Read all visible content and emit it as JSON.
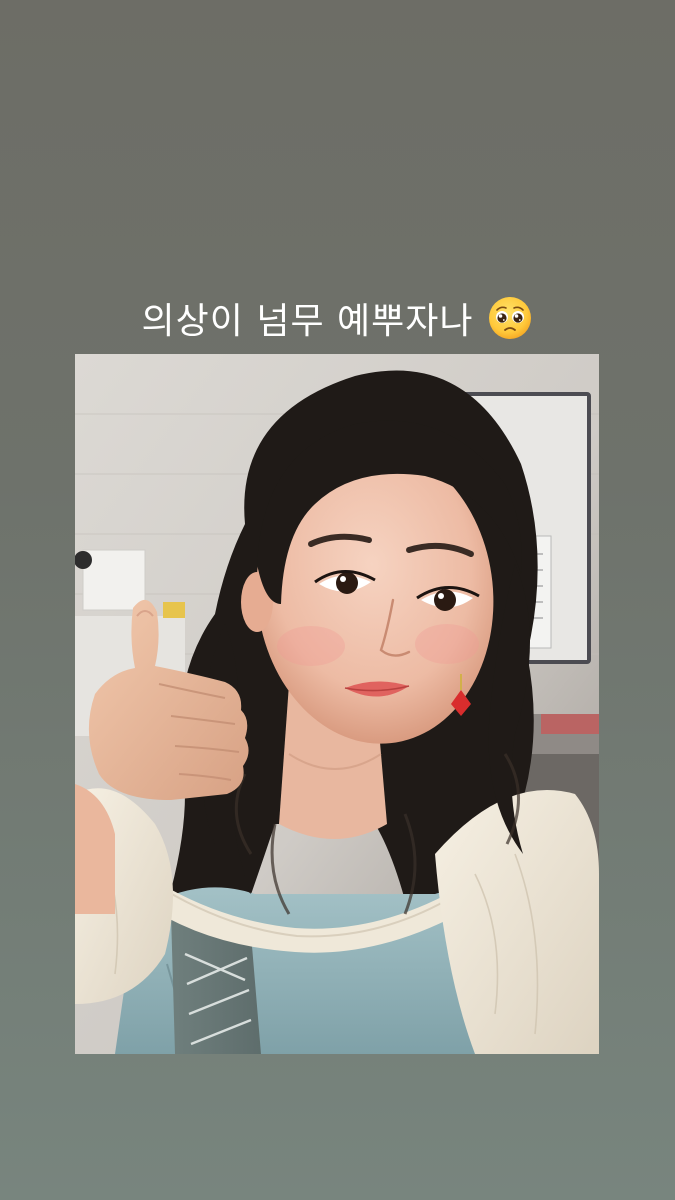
{
  "story": {
    "caption": "의상이 넘무 예뿌자나",
    "emoji_icon": "pleading-face-icon"
  },
  "photo": {
    "subject": "selfie-photo"
  },
  "colors": {
    "background_top": "#6d6d66",
    "background_bottom": "#78857e",
    "caption_text": "#ffffff",
    "dress_blue": "#8fb1b7",
    "blouse_cream": "#efe8d9",
    "hair": "#1f1a17"
  }
}
